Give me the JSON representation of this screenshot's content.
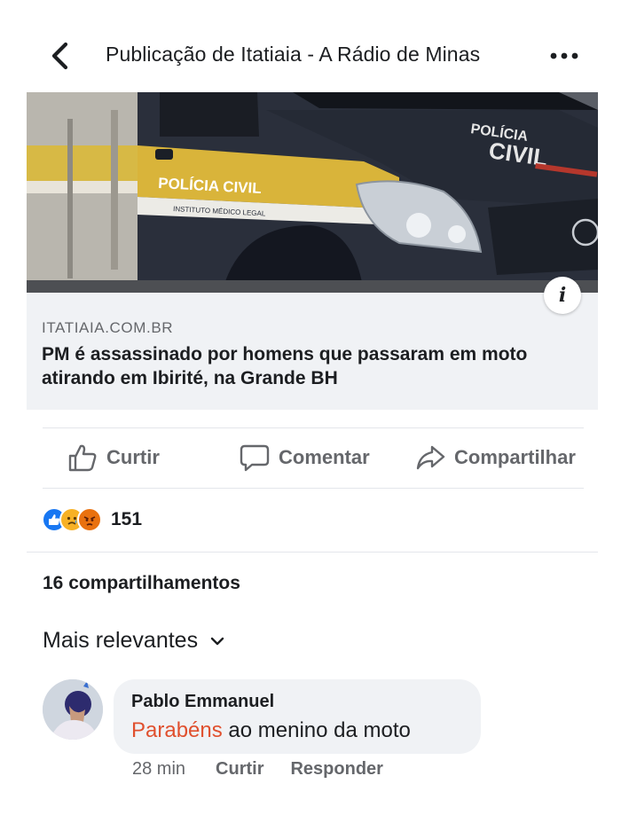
{
  "header": {
    "title": "Publicação de Itatiaia - A Rádio de Minas",
    "back_icon": "chevron-left-icon",
    "more_icon": "ellipsis-icon"
  },
  "link_card": {
    "image_text_side": "POLÍCIA CIVIL",
    "image_text_side_sub": "INSTITUTO MÉDICO LEGAL",
    "image_text_hood": "POLÍCIA CIVIL",
    "info_glyph": "i",
    "domain": "ITATIAIA.COM.BR",
    "headline": "PM é assassinado por homens que passaram em moto atirando em Ibirité, na Grande BH"
  },
  "actions": {
    "like_label": "Curtir",
    "comment_label": "Comentar",
    "share_label": "Compartilhar"
  },
  "reactions": {
    "types": [
      "like",
      "sad",
      "angry"
    ],
    "count": "151",
    "colors": {
      "like": "#1877f2",
      "sad": "#f7b125",
      "angry": "#e9710f"
    }
  },
  "shares": {
    "label": "16 compartilhamentos"
  },
  "sort": {
    "label": "Mais relevantes"
  },
  "comment": {
    "author": "Pablo Emmanuel",
    "tagged": "Parabéns",
    "text": " ao menino da moto",
    "time": "28 min",
    "like_label": "Curtir",
    "reply_label": "Responder",
    "tag_color": "#e0502e"
  }
}
